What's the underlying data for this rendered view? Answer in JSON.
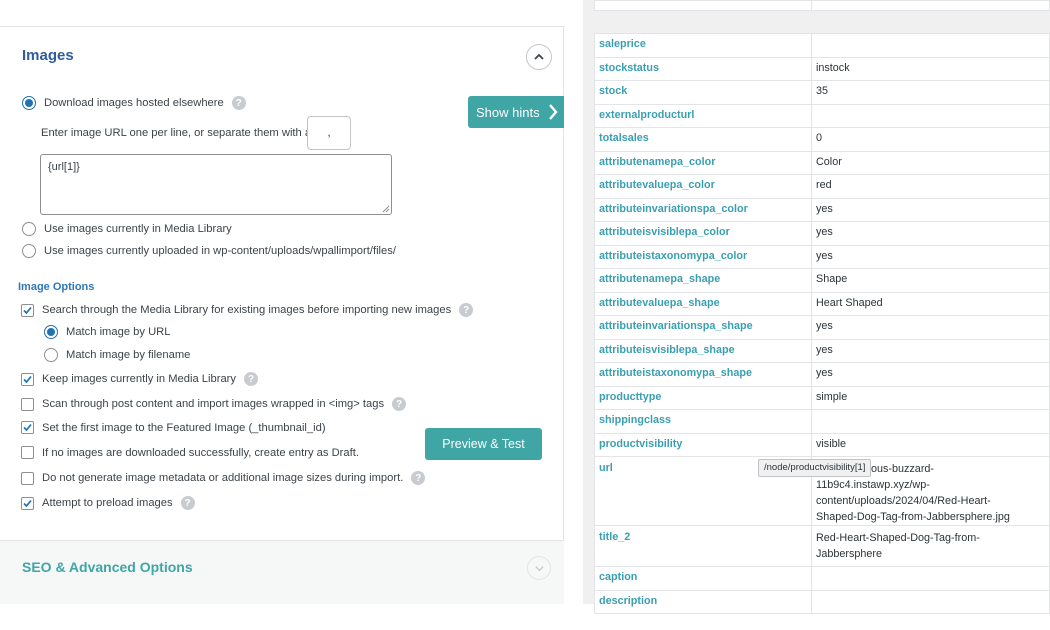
{
  "images_section": {
    "title": "Images",
    "source_options": {
      "download_label": "Download images hosted elsewhere",
      "enter_urls_label": "Enter image URL one per line, or separate them with a",
      "separator_value": ",",
      "url_template_value": "{url[1]}",
      "media_library_label": "Use images currently in Media Library",
      "uploaded_label": "Use images currently uploaded in wp-content/uploads/wpallimport/files/"
    },
    "show_hints_label": "Show hints",
    "image_options": {
      "heading": "Image Options",
      "search_media_label": "Search through the Media Library for existing images before importing new images",
      "match_url_label": "Match image by URL",
      "match_filename_label": "Match image by filename",
      "keep_images_label": "Keep images currently in Media Library",
      "scan_post_label": "Scan through post content and import images wrapped in <img> tags",
      "featured_label": "Set the first image to the Featured Image (_thumbnail_id)",
      "draft_label": "If no images are downloaded successfully, create entry as Draft.",
      "no_metadata_label": "Do not generate image metadata or additional image sizes during import.",
      "preload_label": "Attempt to preload images"
    },
    "preview_label": "Preview & Test"
  },
  "seo_section": {
    "title": "SEO & Advanced Options"
  },
  "record_table": {
    "rows": [
      {
        "key": "saleprice",
        "value": ""
      },
      {
        "key": "stockstatus",
        "value": "instock"
      },
      {
        "key": "stock",
        "value": "35"
      },
      {
        "key": "externalproducturl",
        "value": ""
      },
      {
        "key": "totalsales",
        "value": "0"
      },
      {
        "key": "attributenamepa_color",
        "value": "Color"
      },
      {
        "key": "attributevaluepa_color",
        "value": "red"
      },
      {
        "key": "attributeinvariationspa_color",
        "value": "yes"
      },
      {
        "key": "attributeisvisiblepa_color",
        "value": "yes"
      },
      {
        "key": "attributeistaxonomypa_color",
        "value": "yes"
      },
      {
        "key": "attributenamepa_shape",
        "value": "Shape"
      },
      {
        "key": "attributevaluepa_shape",
        "value": "Heart Shaped"
      },
      {
        "key": "attributeinvariationspa_shape",
        "value": "yes"
      },
      {
        "key": "attributeisvisiblepa_shape",
        "value": "yes"
      },
      {
        "key": "attributeistaxonomypa_shape",
        "value": "yes"
      },
      {
        "key": "producttype",
        "value": "simple"
      },
      {
        "key": "shippingclass",
        "value": ""
      },
      {
        "key": "productvisibility",
        "value": "visible"
      }
    ],
    "url_row": {
      "key": "url",
      "line1": "ous-buzzard-",
      "line2": "11b9c4.instawp.xyz/wp-",
      "line3": "content/uploads/2024/04/Red-Heart-",
      "line4": "Shaped-Dog-Tag-from-Jabbersphere.jpg"
    },
    "title2_row": {
      "key": "title_2",
      "line1": "Red-Heart-Shaped-Dog-Tag-from-",
      "line2": "Jabbersphere"
    },
    "caption_row": {
      "key": "caption",
      "value": ""
    },
    "description_row": {
      "key": "description",
      "value": ""
    },
    "tooltip": "/node/productvisibility[1]"
  }
}
